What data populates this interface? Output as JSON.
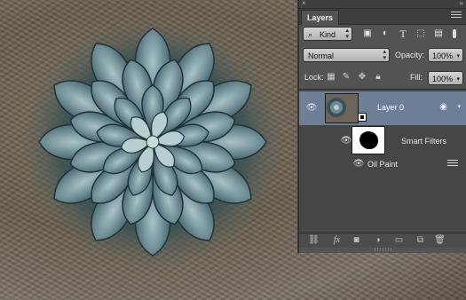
{
  "panel": {
    "collapse_glyph": "×",
    "top_menu_glyph": "»",
    "tab_label": "Layers"
  },
  "filter_row": {
    "kind_label": "Kind",
    "icons": [
      "pixel-filter-icon",
      "adjustment-filter-icon",
      "type-filter-icon",
      "shape-filter-icon",
      "smart-object-filter-icon",
      "filter-toggle"
    ]
  },
  "blend_row": {
    "mode": "Normal",
    "opacity_label": "Opacity:",
    "opacity_value": "100%"
  },
  "lock_row": {
    "lock_label": "Lock:",
    "fill_label": "Fill:",
    "fill_value": "100%"
  },
  "layers": {
    "layer0_name": "Layer 0",
    "smart_filters_label": "Smart Filters",
    "oil_paint_label": "Oil Paint"
  },
  "bottom_bar": {
    "icons": [
      "link-layers-icon",
      "fx-icon",
      "add-mask-icon",
      "adjustment-layer-icon",
      "new-group-icon",
      "new-layer-icon",
      "delete-layer-icon"
    ]
  },
  "colors": {
    "panel_bg": "#535353",
    "selected_layer": "#6c7f96"
  }
}
